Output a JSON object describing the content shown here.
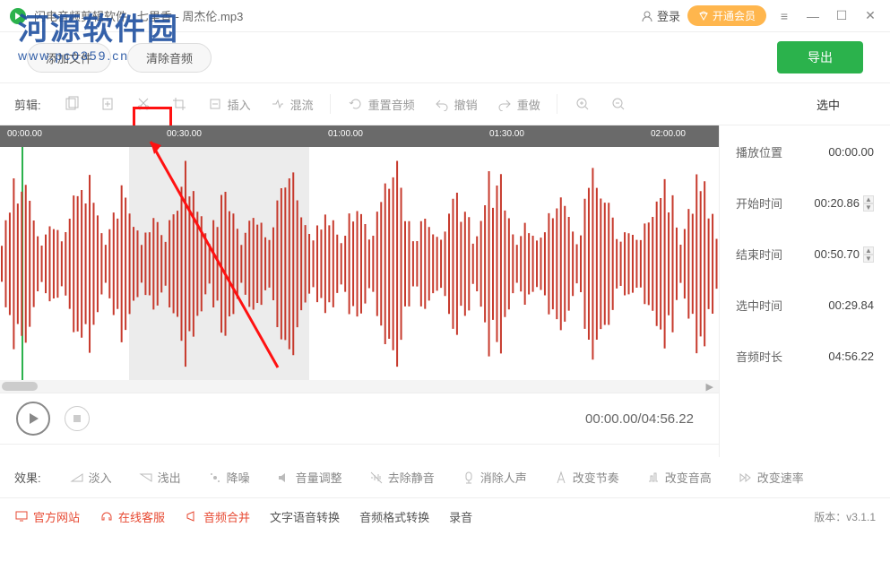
{
  "titlebar": {
    "app_name": "闪电音频剪辑软件",
    "file_title": "七里香 - 周杰伦.mp3",
    "login": "登录",
    "vip": "开通会员"
  },
  "actions": {
    "add_file": "添加文件",
    "clear_audio": "清除音频",
    "export": "导出"
  },
  "toolbar": {
    "label": "剪辑:",
    "insert": "插入",
    "mix": "混流",
    "reset": "重置音频",
    "undo": "撤销",
    "redo": "重做",
    "selected_heading": "选中"
  },
  "ruler": {
    "ticks": [
      "00:00.00",
      "00:30.00",
      "01:00.00",
      "01:30.00",
      "02:00.00"
    ]
  },
  "side": {
    "play_pos_label": "播放位置",
    "play_pos": "00:00.00",
    "start_label": "开始时间",
    "start": "00:20.86",
    "end_label": "结束时间",
    "end": "00:50.70",
    "sel_label": "选中时间",
    "sel": "00:29.84",
    "dur_label": "音频时长",
    "dur": "04:56.22"
  },
  "playbar": {
    "time": "00:00.00/04:56.22"
  },
  "fx": {
    "label": "效果:",
    "fade_in": "淡入",
    "fade_out": "浅出",
    "denoise": "降噪",
    "volume": "音量调整",
    "silence": "去除静音",
    "vocal": "消除人声",
    "tempo": "改变节奏",
    "pitch": "改变音高",
    "speed": "改变速率"
  },
  "bottom": {
    "site": "官方网站",
    "cs": "在线客服",
    "merge": "音频合并",
    "tts": "文字语音转换",
    "format": "音频格式转换",
    "record": "录音",
    "version_label": "版本：",
    "version": "v3.1.1"
  },
  "watermark": {
    "name": "河源软件园",
    "url": "www.pc0359.cn"
  },
  "chart_data": {
    "type": "waveform",
    "selection": {
      "start_pct": 18,
      "end_pct": 43
    },
    "playhead_pct": 3,
    "duration": "04:56.22",
    "visible_range": [
      "00:00.00",
      "02:10.00"
    ]
  }
}
